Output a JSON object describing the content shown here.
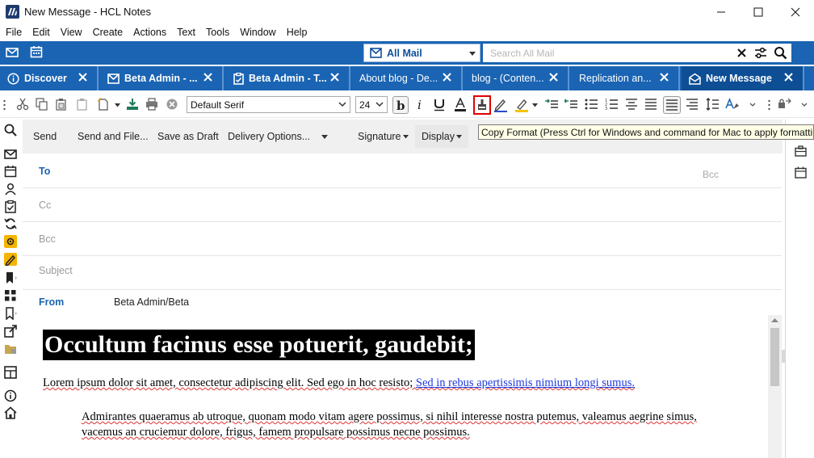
{
  "window": {
    "title": "New Message - HCL Notes"
  },
  "menu": [
    "File",
    "Edit",
    "View",
    "Create",
    "Actions",
    "Text",
    "Tools",
    "Window",
    "Help"
  ],
  "quickbar": {
    "mail_selector": "All Mail",
    "search_placeholder": "Search All Mail"
  },
  "tabs": [
    {
      "label": "Discover",
      "icon": "info-icon"
    },
    {
      "label": "Beta Admin - ...",
      "icon": "mail-icon"
    },
    {
      "label": "Beta Admin - T...",
      "icon": "clipboard-icon"
    },
    {
      "label": "About blog - De...",
      "icon": ""
    },
    {
      "label": "blog - (Conten...",
      "icon": ""
    },
    {
      "label": "Replication an...",
      "icon": ""
    },
    {
      "label": "New Message",
      "icon": "open-mail-icon"
    }
  ],
  "toolbar": {
    "font": "Default Serif",
    "size": "24"
  },
  "tooltip": "Copy Format (Press Ctrl for Windows and command for Mac to apply formatting)",
  "actions": {
    "send": "Send",
    "send_and_file": "Send and File...",
    "save_draft": "Save as Draft",
    "delivery_options": "Delivery Options...",
    "signature": "Signature",
    "display": "Display"
  },
  "fields": {
    "to": "To",
    "cc": "Cc",
    "bcc": "Bcc",
    "bcc_link": "Bcc",
    "subject": "Subject",
    "from": "From",
    "from_value": "Beta Admin/Beta"
  },
  "body": {
    "heading": "Occultum facinus esse potuerit, gaudebit;",
    "para1_text": "Lorem ipsum dolor sit amet, consectetur adipiscing elit. Sed ego in hoc resisto; ",
    "para1_link": "Sed in rebus apertissimis nimium longi sumus.",
    "para2": "Admirantes quaeramus ab utroque, quonam modo vitam agere possimus, si nihil interesse nostra putemus, valeamus aegrine simus, vacemus an cruciemur dolore, frigus, famem propulsare possimus necne possimus."
  },
  "colors": {
    "brand_blue": "#1a64b3",
    "active_tab": "#0d4e95",
    "highlight_red": "#e00000"
  }
}
